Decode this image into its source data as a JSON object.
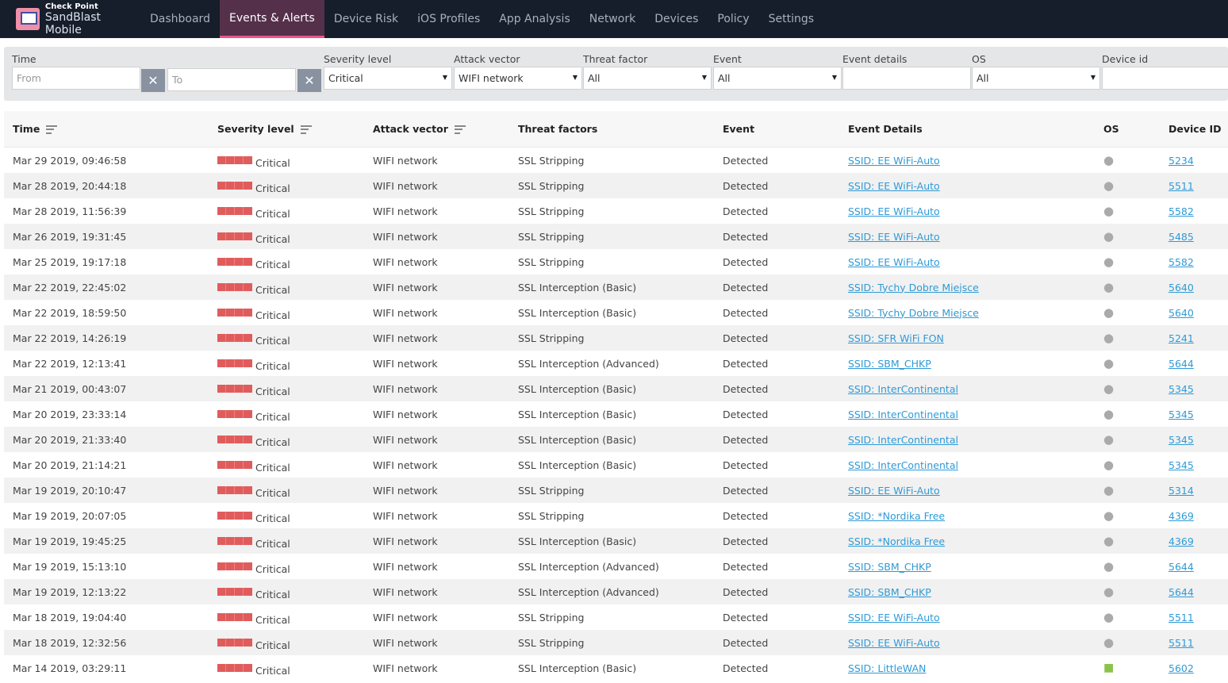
{
  "brand": {
    "top": "Check Point",
    "name": "SandBlast Mobile"
  },
  "nav": [
    "Dashboard",
    "Events & Alerts",
    "Device Risk",
    "iOS Profiles",
    "App Analysis",
    "Network",
    "Devices",
    "Policy",
    "Settings"
  ],
  "nav_active": 1,
  "filters": {
    "time": "Time",
    "from": "From",
    "to": "To",
    "severity_label": "Severity level",
    "severity": "Critical",
    "vector_label": "Attack vector",
    "vector": "WIFI network",
    "threat_label": "Threat factor",
    "threat": "All",
    "event_label": "Event",
    "event": "All",
    "details_label": "Event details",
    "details": "",
    "os_label": "OS",
    "os": "All",
    "device_label": "Device id",
    "device": ""
  },
  "columns": [
    "Time",
    "Severity level",
    "Attack vector",
    "Threat factors",
    "Event",
    "Event Details",
    "OS",
    "Device ID"
  ],
  "colors": {
    "critical": "#e05c5c",
    "link": "#2f9ad6",
    "accent": "#e8558a"
  },
  "rows": [
    [
      "Mar 29 2019, 09:46:58",
      "SSL Stripping",
      "SSID: EE WiFi-Auto",
      "apple",
      "5234"
    ],
    [
      "Mar 28 2019, 20:44:18",
      "SSL Stripping",
      "SSID: EE WiFi-Auto",
      "apple",
      "5511"
    ],
    [
      "Mar 28 2019, 11:56:39",
      "SSL Stripping",
      "SSID: EE WiFi-Auto",
      "apple",
      "5582"
    ],
    [
      "Mar 26 2019, 19:31:45",
      "SSL Stripping",
      "SSID: EE WiFi-Auto",
      "apple",
      "5485"
    ],
    [
      "Mar 25 2019, 19:17:18",
      "SSL Stripping",
      "SSID: EE WiFi-Auto",
      "apple",
      "5582"
    ],
    [
      "Mar 22 2019, 22:45:02",
      "SSL Interception (Basic)",
      "SSID: Tychy Dobre Miejsce",
      "apple",
      "5640"
    ],
    [
      "Mar 22 2019, 18:59:50",
      "SSL Interception (Basic)",
      "SSID: Tychy Dobre Miejsce",
      "apple",
      "5640"
    ],
    [
      "Mar 22 2019, 14:26:19",
      "SSL Stripping",
      "SSID: SFR WiFi FON",
      "apple",
      "5241"
    ],
    [
      "Mar 22 2019, 12:13:41",
      "SSL Interception (Advanced)",
      "SSID: SBM_CHKP",
      "apple",
      "5644"
    ],
    [
      "Mar 21 2019, 00:43:07",
      "SSL Interception (Basic)",
      "SSID: InterContinental",
      "apple",
      "5345"
    ],
    [
      "Mar 20 2019, 23:33:14",
      "SSL Interception (Basic)",
      "SSID: InterContinental",
      "apple",
      "5345"
    ],
    [
      "Mar 20 2019, 21:33:40",
      "SSL Interception (Basic)",
      "SSID: InterContinental",
      "apple",
      "5345"
    ],
    [
      "Mar 20 2019, 21:14:21",
      "SSL Interception (Basic)",
      "SSID: InterContinental",
      "apple",
      "5345"
    ],
    [
      "Mar 19 2019, 20:10:47",
      "SSL Stripping",
      "SSID: EE WiFi-Auto",
      "apple",
      "5314"
    ],
    [
      "Mar 19 2019, 20:07:05",
      "SSL Stripping",
      "SSID: *Nordika Free",
      "apple",
      "4369"
    ],
    [
      "Mar 19 2019, 19:45:25",
      "SSL Interception (Basic)",
      "SSID: *Nordika Free",
      "apple",
      "4369"
    ],
    [
      "Mar 19 2019, 15:13:10",
      "SSL Interception (Advanced)",
      "SSID: SBM_CHKP",
      "apple",
      "5644"
    ],
    [
      "Mar 19 2019, 12:13:22",
      "SSL Interception (Advanced)",
      "SSID: SBM_CHKP",
      "apple",
      "5644"
    ],
    [
      "Mar 18 2019, 19:04:40",
      "SSL Stripping",
      "SSID: EE WiFi-Auto",
      "apple",
      "5511"
    ],
    [
      "Mar 18 2019, 12:32:56",
      "SSL Stripping",
      "SSID: EE WiFi-Auto",
      "apple",
      "5511"
    ],
    [
      "Mar 14 2019, 03:29:11",
      "SSL Interception (Basic)",
      "SSID: LittleWAN",
      "android",
      "5602"
    ]
  ],
  "row_common": {
    "severity": "Critical",
    "vector": "WIFI network",
    "event": "Detected"
  }
}
